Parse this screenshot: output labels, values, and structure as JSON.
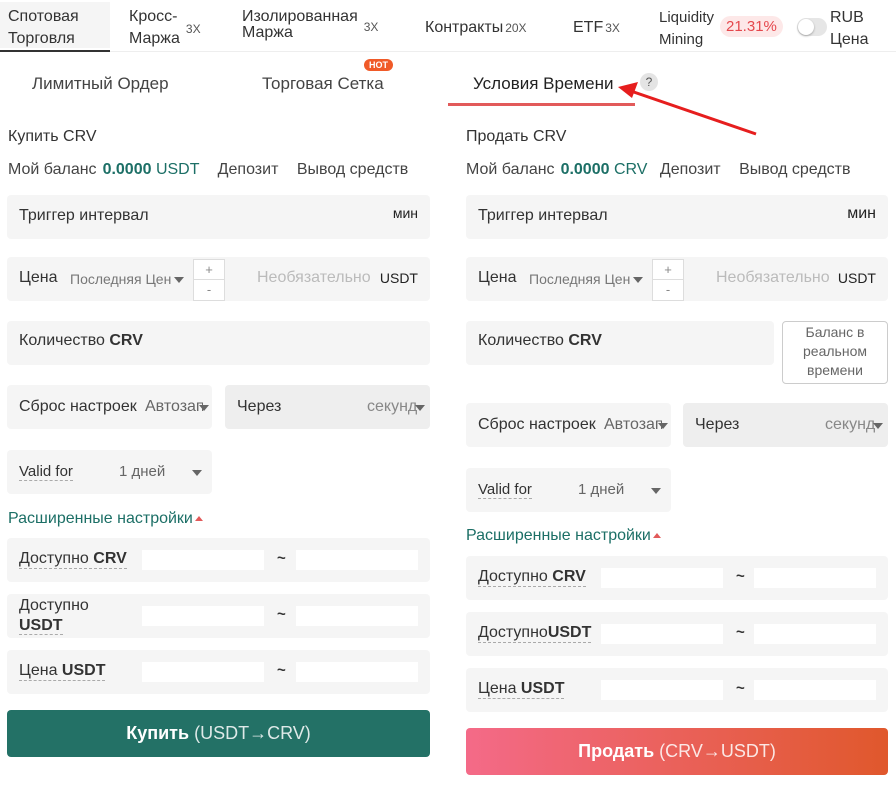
{
  "top_tabs": [
    {
      "label_line1": "Спотовая",
      "label_line2": "Торговля",
      "leverage": ""
    },
    {
      "label_line1": "Кросс-",
      "label_line2": "Маржа",
      "leverage": "3X"
    },
    {
      "label_line1": "Изолированная",
      "label_line2": "Маржа",
      "leverage": "3X"
    },
    {
      "label_line1": "Контракты",
      "label_line2": "",
      "leverage": "20X"
    },
    {
      "label_line1": "ETF",
      "label_line2": "",
      "leverage": "3X"
    },
    {
      "label_line1": "Liquidity",
      "label_line2": "Mining",
      "leverage": ""
    }
  ],
  "liquidity_pct": "21.31%",
  "currency_toggle": {
    "line1": "RUB",
    "line2": "Цена"
  },
  "order_tabs": {
    "limit": "Лимитный Ордер",
    "grid": "Торговая Сетка",
    "hot": "HOT",
    "time": "Условия Времени",
    "help": "?"
  },
  "buy": {
    "title": "Купить CRV",
    "balance_label": "Мой баланс",
    "balance_value": "0.0000",
    "balance_currency": "USDT",
    "deposit": "Депозит",
    "withdraw": "Вывод средств",
    "trigger_label": "Триггер интервал",
    "trigger_unit": "мин",
    "price_label": "Цена",
    "price_type": "Последняя Цена",
    "price_placeholder": "Необязательно",
    "price_unit": "USDT",
    "plus": "+",
    "minus": "-",
    "qty_label": "Количество",
    "qty_currency": "CRV",
    "reset_label": "Сброс настроек",
    "reset_value": "Автозапуск",
    "after_label": "Через",
    "after_value": "секунд",
    "valid_label": "Valid for",
    "valid_value": "1 дней",
    "advanced": "Расширенные настройки",
    "avail1_label": "Доступно",
    "avail1_cur": "CRV",
    "avail2_label": "Доступно",
    "avail2_cur": "USDT",
    "price_range_label": "Цена",
    "price_range_cur": "USDT",
    "tilde": "~",
    "button": "Купить",
    "button_pair": "(USDT→CRV)"
  },
  "sell": {
    "title": "Продать CRV",
    "balance_label": "Мой баланс",
    "balance_value": "0.0000",
    "balance_currency": "CRV",
    "deposit": "Депозит",
    "withdraw": "Вывод средств",
    "trigger_label": "Триггер интервал",
    "trigger_unit": "мин",
    "price_label": "Цена",
    "price_type": "Последняя Цена",
    "price_placeholder": "Необязательно",
    "price_unit": "USDT",
    "plus": "+",
    "minus": "-",
    "qty_label": "Количество",
    "qty_currency": "CRV",
    "realtime_balance": [
      "Баланс в",
      "реальном",
      "времени"
    ],
    "reset_label": "Сброс настроек",
    "reset_value": "Автозапуск",
    "after_label": "Через",
    "after_value": "секунд",
    "valid_label": "Valid for",
    "valid_value": "1 дней",
    "advanced": "Расширенные настройки",
    "avail1_label": "Доступно",
    "avail1_cur": "CRV",
    "avail2_label": "Доступно",
    "avail2_cur": "USDT",
    "price_range_label": "Цена",
    "price_range_cur": "USDT",
    "tilde": "~",
    "button": "Продать",
    "button_pair": "(CRV→USDT)"
  },
  "colors": {
    "accent_green": "#237166",
    "accent_red": "#e25a5a",
    "sell_gradient_start": "#f46a88",
    "sell_gradient_end": "#e0582c"
  },
  "icons": {
    "help": "question-circle-icon",
    "caret": "caret-down-icon",
    "arrow": "red-annotation-arrow"
  }
}
